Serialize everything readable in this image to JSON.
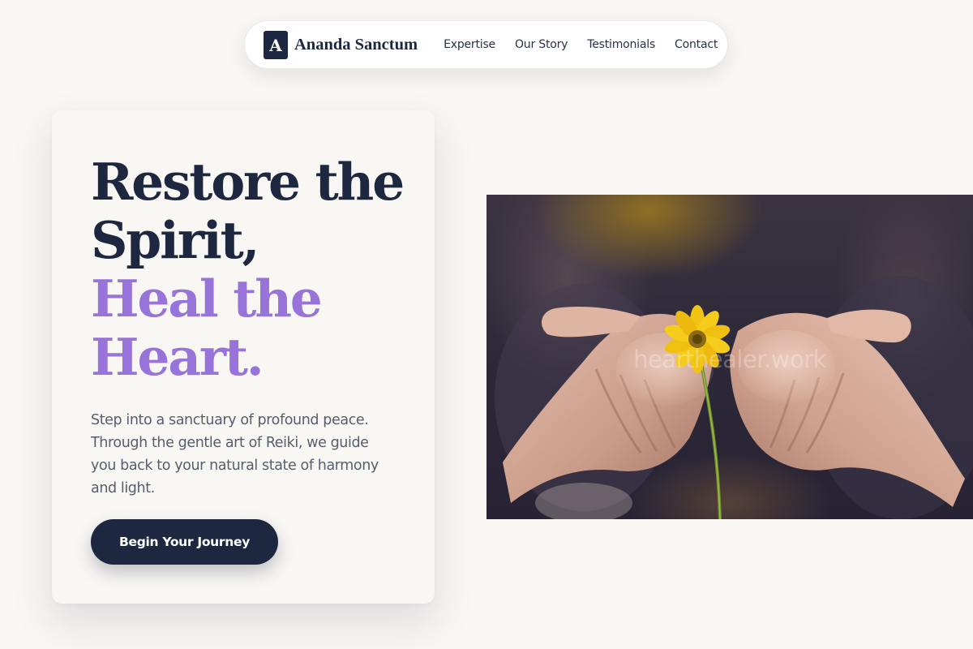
{
  "brand": {
    "logo_letter": "A",
    "name": "Ananda Sanctum"
  },
  "nav": {
    "links": [
      "Expertise",
      "Our Story",
      "Testimonials",
      "Contact"
    ]
  },
  "hero": {
    "headline_line1": "Restore the",
    "headline_line2": "Spirit,",
    "headline_line3": "Heal the",
    "headline_line4": "Heart.",
    "lead": "Step into a sanctuary of profound peace. Through the gentle art of Reiki, we guide you back to your natural state of harmony and light.",
    "cta_label": "Begin Your Journey"
  },
  "photo": {
    "subject": "open-hands-holding-yellow-flower-photo",
    "watermark": "hearthealer.work"
  },
  "colors": {
    "navy": "#1e2740",
    "accent_purple": "#9873d9",
    "background": "#f9f7f4",
    "text_muted": "#565d6d",
    "flower_yellow": "#f2c414"
  }
}
